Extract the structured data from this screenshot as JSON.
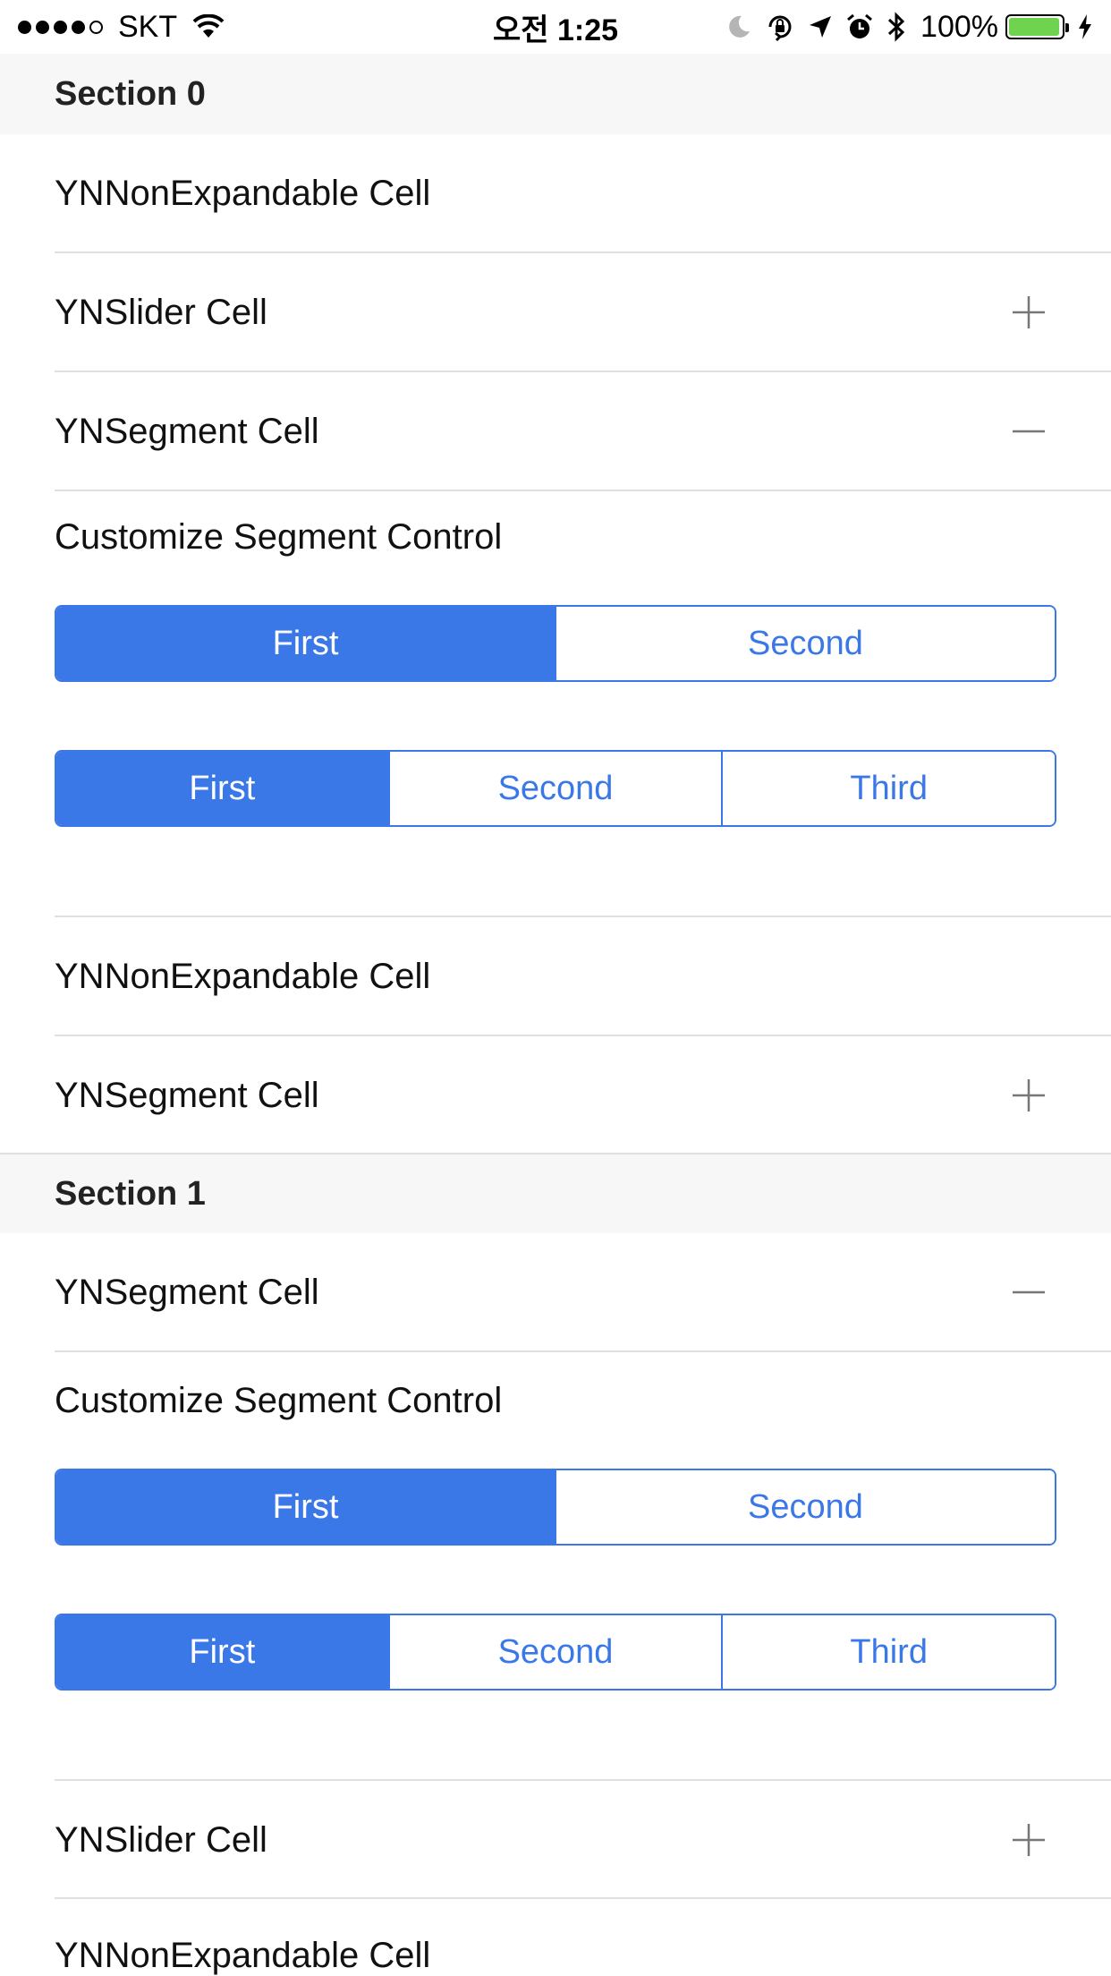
{
  "status_bar": {
    "carrier": "SKT",
    "time": "오전 1:25",
    "battery_percent": "100%",
    "battery_level": 1.0
  },
  "sections": [
    {
      "title": "Section 0",
      "rows": [
        {
          "label": "YNNonExpandable Cell",
          "accessory": "none"
        },
        {
          "label": "YNSlider Cell",
          "accessory": "plus-icon"
        },
        {
          "label": "YNSegment Cell",
          "accessory": "minus-icon"
        },
        {
          "label": "Customize Segment Control",
          "segments_two": [
            {
              "label": "First",
              "selected": true
            },
            {
              "label": "Second",
              "selected": false
            }
          ],
          "segments_three": [
            {
              "label": "First",
              "selected": true
            },
            {
              "label": "Second",
              "selected": false
            },
            {
              "label": "Third",
              "selected": false
            }
          ]
        },
        {
          "label": "YNNonExpandable Cell",
          "accessory": "none"
        },
        {
          "label": "YNSegment Cell",
          "accessory": "plus-icon"
        }
      ]
    },
    {
      "title": "Section 1",
      "rows": [
        {
          "label": "YNSegment Cell",
          "accessory": "minus-icon"
        },
        {
          "label": "Customize Segment Control",
          "segments_two": [
            {
              "label": "First",
              "selected": true
            },
            {
              "label": "Second",
              "selected": false
            }
          ],
          "segments_three": [
            {
              "label": "First",
              "selected": true
            },
            {
              "label": "Second",
              "selected": false
            },
            {
              "label": "Third",
              "selected": false
            }
          ]
        },
        {
          "label": "YNSlider Cell",
          "accessory": "plus-icon"
        },
        {
          "label": "YNNonExpandable Cell",
          "accessory": "none"
        }
      ]
    }
  ],
  "colors": {
    "accent": "#3b78e7",
    "header_background": "#f7f7f7",
    "separator": "#e0e0e0",
    "battery_fill": "#6fd34f"
  }
}
